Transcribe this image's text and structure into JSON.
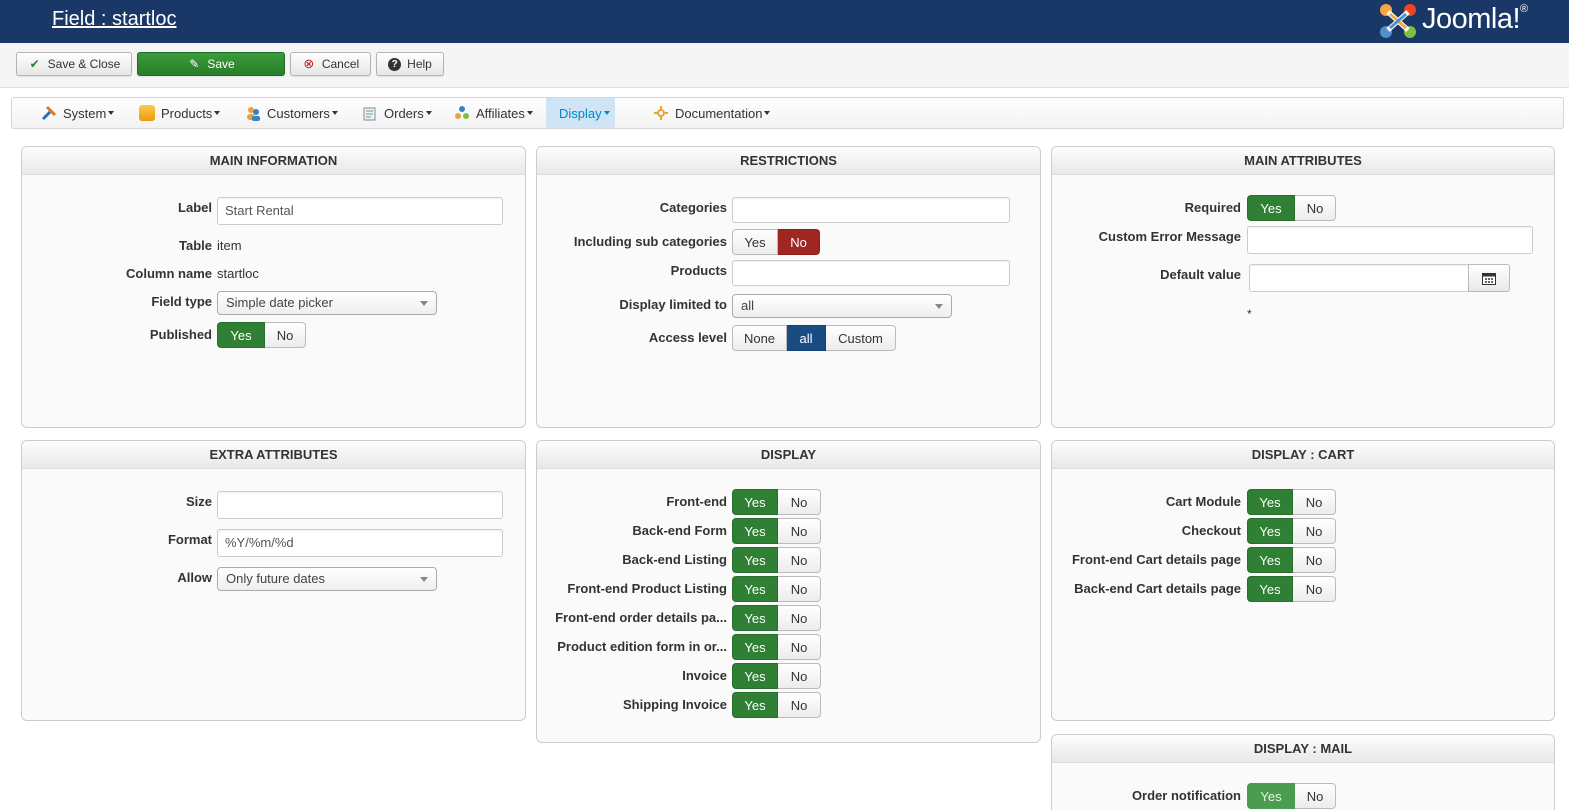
{
  "header": {
    "title": "Field : startloc",
    "logo_text": "Joomla!",
    "logo_reg": "®"
  },
  "toolbar": {
    "save_close": "Save & Close",
    "save": "Save",
    "cancel": "Cancel",
    "help": "Help"
  },
  "menu": {
    "system": "System",
    "products": "Products",
    "customers": "Customers",
    "orders": "Orders",
    "affiliates": "Affiliates",
    "display": "Display",
    "documentation": "Documentation"
  },
  "main_info": {
    "title": "MAIN INFORMATION",
    "label_label": "Label",
    "label_value": "Start Rental",
    "table_label": "Table",
    "table_value": "item",
    "column_label": "Column name",
    "column_value": "startloc",
    "fieldtype_label": "Field type",
    "fieldtype_value": "Simple date picker",
    "published_label": "Published",
    "yes": "Yes",
    "no": "No"
  },
  "restrictions": {
    "title": "RESTRICTIONS",
    "categories_label": "Categories",
    "subcats_label": "Including sub categories",
    "products_label": "Products",
    "display_limited_label": "Display limited to",
    "display_limited_value": "all",
    "access_label": "Access level",
    "access_none": "None",
    "access_all": "all",
    "access_custom": "Custom",
    "yes": "Yes",
    "no": "No"
  },
  "main_attributes": {
    "title": "MAIN ATTRIBUTES",
    "required_label": "Required",
    "custom_error_label": "Custom Error Message",
    "default_value_label": "Default value",
    "asterisk": "*",
    "yes": "Yes",
    "no": "No"
  },
  "extra_attributes": {
    "title": "EXTRA ATTRIBUTES",
    "size_label": "Size",
    "format_label": "Format",
    "format_value": "%Y/%m/%d",
    "allow_label": "Allow",
    "allow_value": "Only future dates"
  },
  "display": {
    "title": "DISPLAY",
    "rows": [
      {
        "label": "Front-end"
      },
      {
        "label": "Back-end Form"
      },
      {
        "label": "Back-end Listing"
      },
      {
        "label": "Front-end Product Listing"
      },
      {
        "label": "Front-end order details pa..."
      },
      {
        "label": "Product edition form in or..."
      },
      {
        "label": "Invoice"
      },
      {
        "label": "Shipping Invoice"
      }
    ],
    "yes": "Yes",
    "no": "No"
  },
  "display_cart": {
    "title": "DISPLAY : CART",
    "rows": [
      {
        "label": "Cart Module"
      },
      {
        "label": "Checkout"
      },
      {
        "label": "Front-end Cart details page"
      },
      {
        "label": "Back-end Cart details page"
      }
    ],
    "yes": "Yes",
    "no": "No"
  },
  "display_mail": {
    "title": "DISPLAY : MAIL",
    "order_notification_label": "Order notification",
    "yes": "Yes",
    "no": "No"
  },
  "colors": {
    "header_bg": "#1a3867",
    "yes_green": "#2f7f34",
    "no_red": "#a02622",
    "active_blue": "#1a4c84"
  }
}
